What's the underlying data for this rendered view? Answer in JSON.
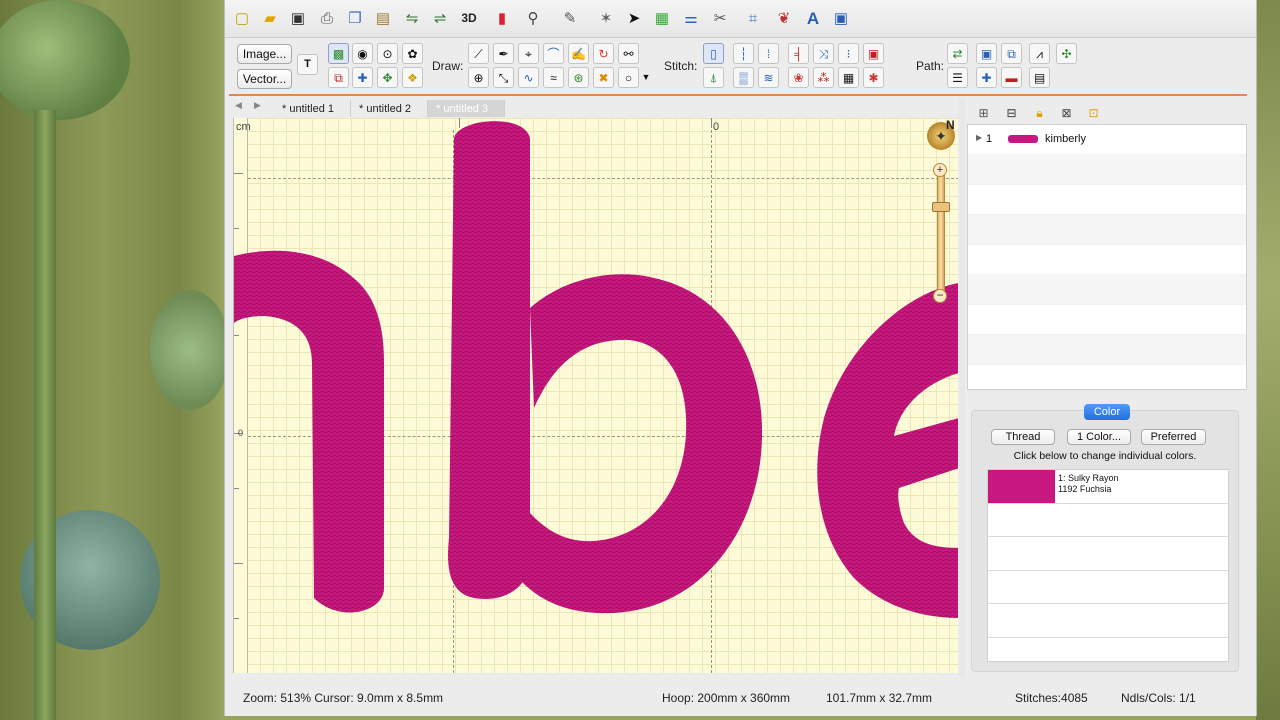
{
  "tabs": [
    "* untitled 1",
    "* untitled 2",
    "* untitled 3"
  ],
  "active_tab": 2,
  "toolbar": {
    "image_label": "Image...",
    "vector_label": "Vector...",
    "draw_label": "Draw:",
    "stitch_label": "Stitch:",
    "path_label": "Path:",
    "threed_label": "3D"
  },
  "canvas": {
    "ruler_unit": "cm",
    "ruler_zero_h": "0",
    "ruler_zero_v": "0",
    "stitch_text": "nbe",
    "thread_color": "#c8177f",
    "compass_n": "N"
  },
  "layers": [
    {
      "index": "1",
      "name": "kimberly"
    }
  ],
  "color_panel": {
    "tab_label": "Color",
    "thread_button": "Thread",
    "colors_button": "1 Color...",
    "preferred_button": "Preferred",
    "hint": "Click below to change individual colors.",
    "threads": [
      {
        "line1": "1: Sulky Rayon",
        "line2": "1192 Fuchsia",
        "swatch": "#c8177f"
      }
    ]
  },
  "status": {
    "zoom_cursor": "Zoom: 513%  Cursor: 9.0mm x 8.5mm",
    "hoop": "Hoop: 200mm x 360mm",
    "size": "101.7mm x 32.7mm",
    "stitches": "Stitches:4085",
    "ndls": "Ndls/Cols: 1/1"
  },
  "colors": {
    "accent_orange": "#e0894a",
    "color_tab_blue": "#2f7fea",
    "canvas_bg": "#fdfbd7"
  }
}
